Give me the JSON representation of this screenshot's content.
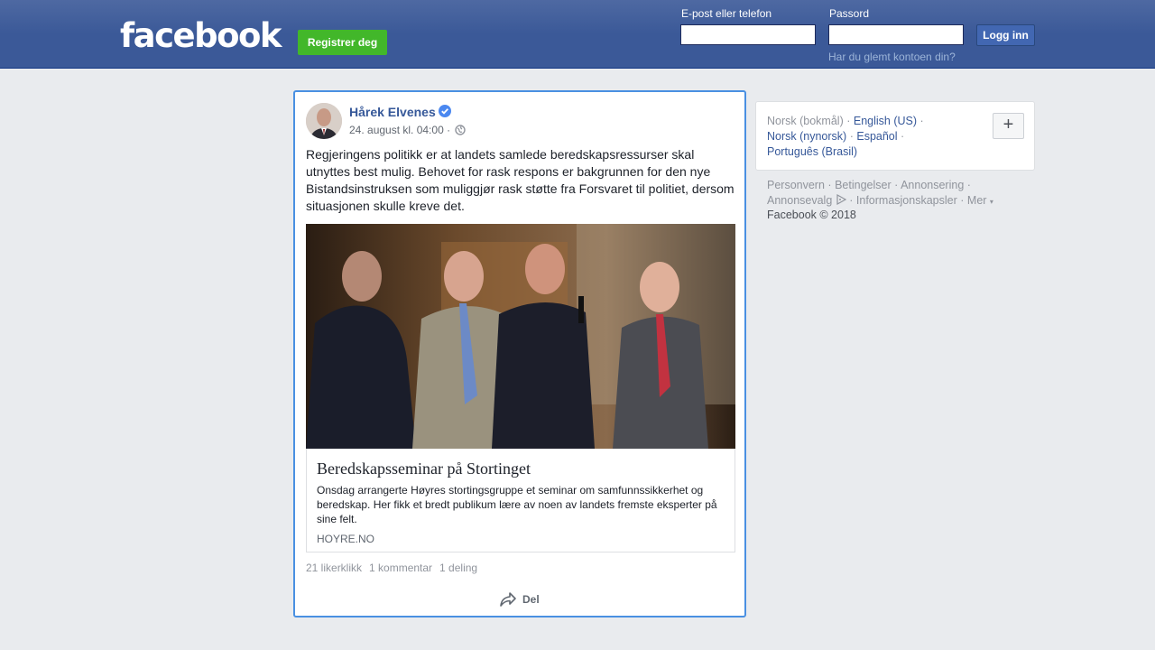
{
  "header": {
    "logo": "facebook",
    "register_label": "Registrer deg",
    "email_label": "E-post eller telefon",
    "email_value": "",
    "password_label": "Passord",
    "password_value": "",
    "login_label": "Logg inn",
    "forgot_label": "Har du glemt kontoen din?",
    "colors": {
      "bar": "#3b5998",
      "register": "#42b72a",
      "login": "#4267b2"
    }
  },
  "post": {
    "author": "Hårek Elvenes",
    "verified_icon": "verified-badge-icon",
    "date": "24. august kl. 04:00 ·",
    "privacy_icon": "globe-icon",
    "text": "Regjeringens politikk er at landets samlede beredskapsressurser skal utnyttes best mulig. Behovet for rask respons er bakgrunnen for den nye Bistandsinstruksen som muliggjør rask støtte fra Forsvaret til politiet, dersom situasjonen skulle kreve det.",
    "link": {
      "title": "Beredskapsseminar på Stortinget",
      "description": "Onsdag arrangerte Høyres stortingsgruppe et seminar om samfunnssikkerhet og beredskap. Her fikk et bredt publikum lære av noen av landets fremste eksperter på sine felt.",
      "domain": "HOYRE.NO"
    },
    "stats": {
      "likes": "21 likerklikk",
      "comments": "1 kommentar",
      "shares": "1 deling"
    },
    "share_label": "Del",
    "share_icon": "share-arrow-icon",
    "border_color": "#4a90e2"
  },
  "sidebar": {
    "languages": [
      {
        "label": "Norsk (bokmål)",
        "current": true
      },
      {
        "label": "English (US)",
        "current": false
      },
      {
        "label": "Norsk (nynorsk)",
        "current": false
      },
      {
        "label": "Español",
        "current": false
      },
      {
        "label": "Português (Brasil)",
        "current": false
      }
    ],
    "add_language_icon": "plus-icon",
    "add_language_label": "+",
    "footer_links": [
      "Personvern",
      "Betingelser",
      "Annonsering",
      "Annonsevalg",
      "Informasjonskapsler",
      "Mer"
    ],
    "sep": "·",
    "copyright": "Facebook © 2018"
  }
}
